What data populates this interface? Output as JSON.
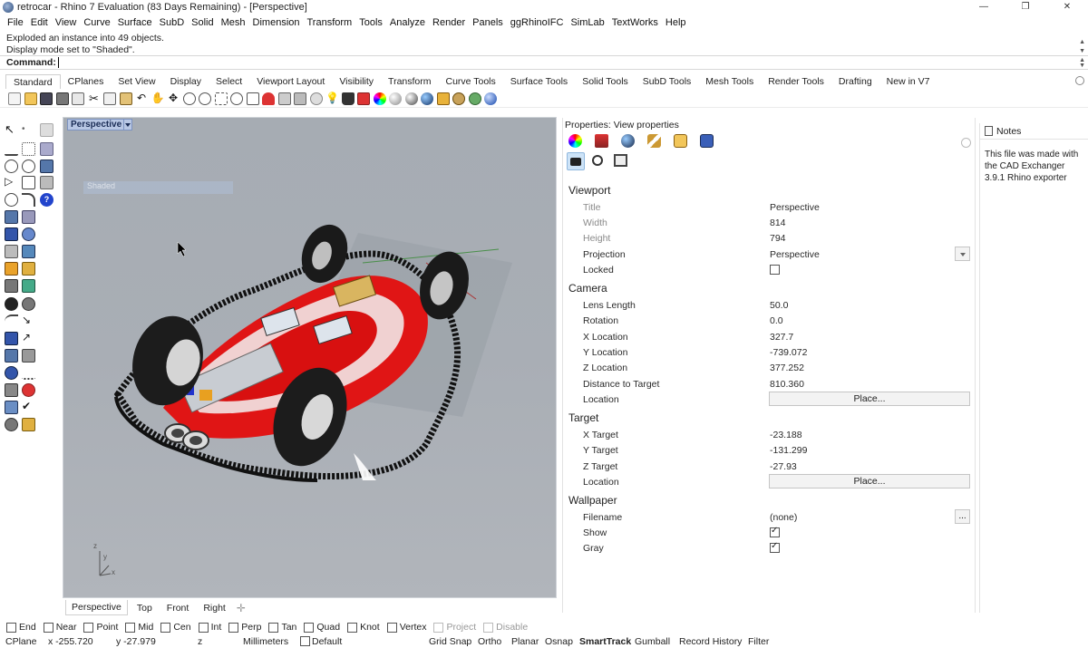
{
  "window": {
    "title": "retrocar - Rhino 7 Evaluation (83 Days Remaining) - [Perspective]",
    "minimize": "—",
    "maximize": "❐",
    "close": "✕"
  },
  "menu": [
    "File",
    "Edit",
    "View",
    "Curve",
    "Surface",
    "SubD",
    "Solid",
    "Mesh",
    "Dimension",
    "Transform",
    "Tools",
    "Analyze",
    "Render",
    "Panels",
    "ggRhinoIFC",
    "SimLab",
    "TextWorks",
    "Help"
  ],
  "command": {
    "history": [
      "Exploded an instance into 49 objects.",
      "Display mode set to \"Shaded\"."
    ],
    "label": "Command:",
    "value": ""
  },
  "toolbar_tabs": [
    "Standard",
    "CPlanes",
    "Set View",
    "Display",
    "Select",
    "Viewport Layout",
    "Visibility",
    "Transform",
    "Curve Tools",
    "Surface Tools",
    "Solid Tools",
    "SubD Tools",
    "Mesh Tools",
    "Render Tools",
    "Drafting",
    "New in V7"
  ],
  "viewport": {
    "name": "Perspective",
    "ghost_label": "Shaded",
    "axes": {
      "z": "z",
      "y": "y",
      "x": "x"
    }
  },
  "viewport_tabs": [
    "Perspective",
    "Top",
    "Front",
    "Right"
  ],
  "properties": {
    "title": "Properties: View properties",
    "sections": {
      "viewport": "Viewport",
      "camera": "Camera",
      "target": "Target",
      "wallpaper": "Wallpaper"
    },
    "viewport": {
      "title_label": "Title",
      "title_value": "Perspective",
      "width_label": "Width",
      "width_value": "814",
      "height_label": "Height",
      "height_value": "794",
      "projection_label": "Projection",
      "projection_value": "Perspective",
      "locked_label": "Locked",
      "locked": false
    },
    "camera": {
      "lens_label": "Lens Length",
      "lens_value": "50.0",
      "rotation_label": "Rotation",
      "rotation_value": "0.0",
      "x_label": "X Location",
      "x_value": "327.7",
      "y_label": "Y Location",
      "y_value": "-739.072",
      "z_label": "Z Location",
      "z_value": "377.252",
      "dist_label": "Distance to Target",
      "dist_value": "810.360",
      "location_label": "Location",
      "place_label": "Place..."
    },
    "target": {
      "x_label": "X Target",
      "x_value": "-23.188",
      "y_label": "Y Target",
      "y_value": "-131.299",
      "z_label": "Z Target",
      "z_value": "-27.93",
      "location_label": "Location",
      "place_label": "Place..."
    },
    "wallpaper": {
      "filename_label": "Filename",
      "filename_value": "(none)",
      "browse_label": "...",
      "show_label": "Show",
      "show": true,
      "gray_label": "Gray",
      "gray": true
    }
  },
  "notes": {
    "title": "Notes",
    "text": "This file was made with the CAD Exchanger 3.9.1 Rhino exporter"
  },
  "osnaps": [
    {
      "label": "End",
      "checked": false,
      "disabled": false
    },
    {
      "label": "Near",
      "checked": false,
      "disabled": false
    },
    {
      "label": "Point",
      "checked": false,
      "disabled": false
    },
    {
      "label": "Mid",
      "checked": false,
      "disabled": false
    },
    {
      "label": "Cen",
      "checked": false,
      "disabled": false
    },
    {
      "label": "Int",
      "checked": false,
      "disabled": false
    },
    {
      "label": "Perp",
      "checked": false,
      "disabled": false
    },
    {
      "label": "Tan",
      "checked": false,
      "disabled": false
    },
    {
      "label": "Quad",
      "checked": false,
      "disabled": false
    },
    {
      "label": "Knot",
      "checked": false,
      "disabled": false
    },
    {
      "label": "Vertex",
      "checked": false,
      "disabled": false
    },
    {
      "label": "Project",
      "checked": false,
      "disabled": true
    },
    {
      "label": "Disable",
      "checked": false,
      "disabled": true
    }
  ],
  "status": {
    "cplane": "CPlane",
    "x": "x -255.720",
    "y": "y -27.979",
    "z": "z",
    "units": "Millimeters",
    "layer": "Default",
    "grid_snap": "Grid Snap",
    "ortho": "Ortho",
    "planar": "Planar",
    "osnap": "Osnap",
    "smarttrack": "SmartTrack",
    "gumball": "Gumball",
    "record_history": "Record History",
    "filter": "Filter"
  }
}
